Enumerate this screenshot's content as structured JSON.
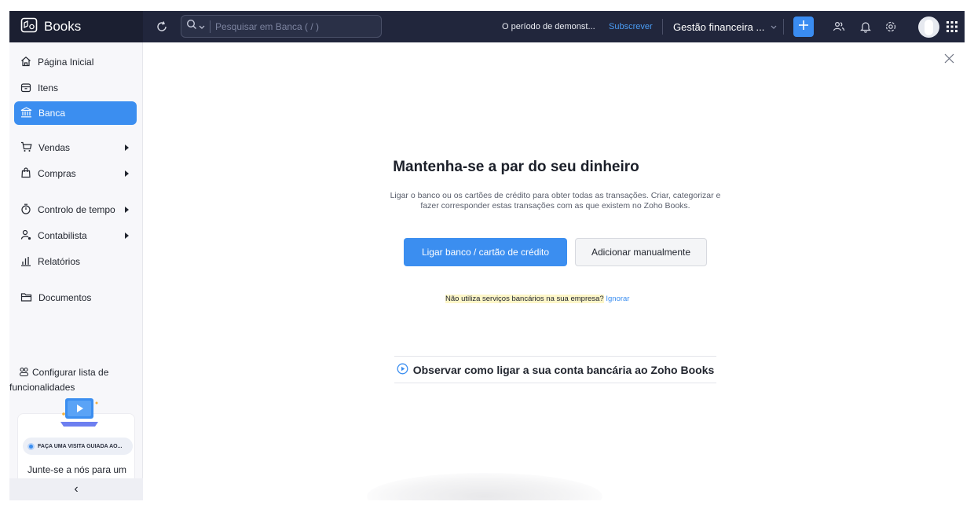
{
  "app": {
    "name": "Books"
  },
  "topbar": {
    "search_placeholder": "Pesquisar em Banca ( / )",
    "trial_text": "O período de demonst...",
    "subscribe_label": "Subscrever",
    "org_name": "Gestão financeira ..."
  },
  "sidebar": {
    "items": [
      {
        "label": "Página Inicial",
        "icon": "home-icon"
      },
      {
        "label": "Itens",
        "icon": "items-icon"
      },
      {
        "label": "Banca",
        "icon": "bank-icon",
        "active": true
      },
      {
        "label": "Vendas",
        "icon": "cart-icon"
      },
      {
        "label": "Compras",
        "icon": "bag-icon"
      },
      {
        "label": "Controlo de tempo",
        "icon": "timer-icon"
      },
      {
        "label": "Contabilista",
        "icon": "accountant-icon"
      },
      {
        "label": "Relatórios",
        "icon": "reports-icon"
      },
      {
        "label": "Documentos",
        "icon": "folder-icon"
      }
    ],
    "config_line1": "Configurar lista de",
    "config_line2": "funcionalidades",
    "promo_badge": "FAÇA UMA VISITA GUIADA AO...",
    "promo_text": "Junte-se a nós para um",
    "collapse_glyph": "‹"
  },
  "main": {
    "heading": "Mantenha-se a par do seu dinheiro",
    "description": "Ligar o banco ou os cartões de crédito para obter todas as transações. Criar, categorizar e fazer corresponder estas transações com as que existem no Zoho Books.",
    "primary_button": "Ligar banco / cartão de crédito",
    "secondary_button": "Adicionar manualmente",
    "no_bank_question": "Não utiliza serviços bancários na sua empresa?",
    "ignore_link": "Ignorar",
    "video_link": "Observar como ligar a sua conta bancária ao Zoho Books"
  },
  "colors": {
    "accent": "#3b8ef0",
    "topbar": "#21263c",
    "highlight": "#fdf6c8"
  }
}
